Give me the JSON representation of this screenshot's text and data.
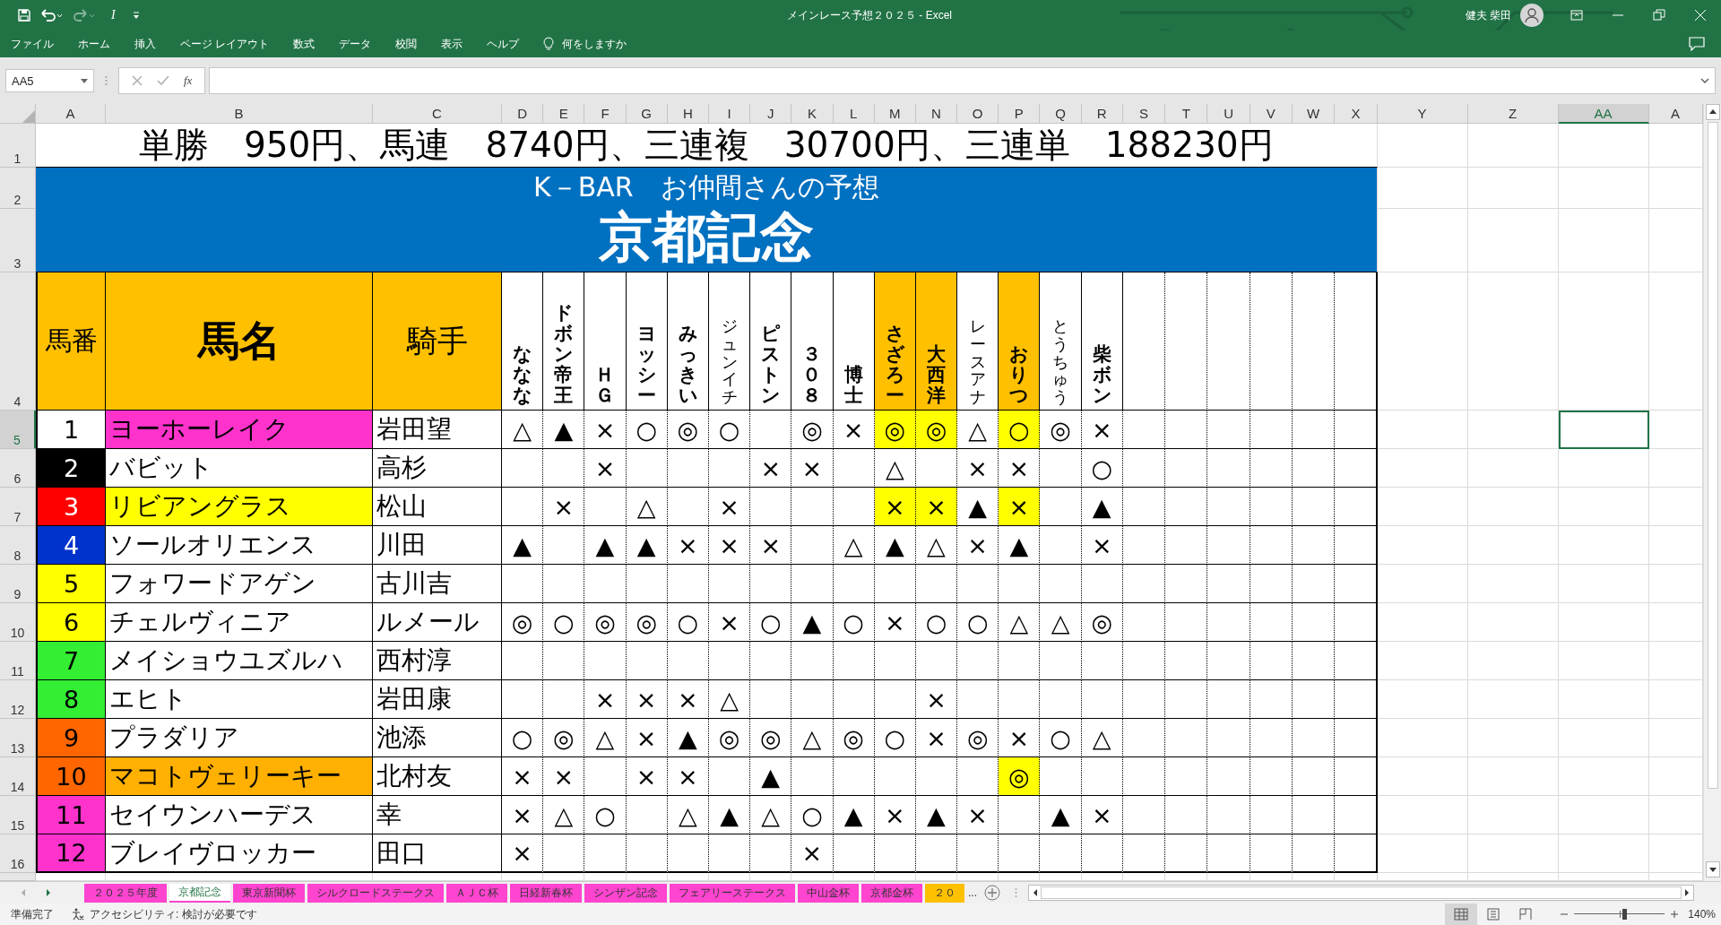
{
  "window": {
    "title": "メインレース予想２０２５  -  Excel",
    "user": "健夫 柴田"
  },
  "quick_access": [
    {
      "kind": "save",
      "disabled": false
    },
    {
      "kind": "undo",
      "disabled": false
    },
    {
      "kind": "redo",
      "disabled": true
    },
    {
      "kind": "text",
      "label": "I",
      "disabled": false
    },
    {
      "kind": "customize",
      "disabled": false
    }
  ],
  "menu": [
    "ファイル",
    "ホーム",
    "挿入",
    "ページ レイアウト",
    "数式",
    "データ",
    "校閲",
    "表示",
    "ヘルプ"
  ],
  "tell_me": "何をしますか",
  "formula_bar": {
    "name_box": "AA5",
    "function_label": "fx"
  },
  "sheet": {
    "columns": [
      {
        "label": "A",
        "selected": false
      },
      {
        "label": "B",
        "selected": false
      },
      {
        "label": "C",
        "selected": false
      },
      {
        "label": "D",
        "selected": false
      },
      {
        "label": "E",
        "selected": false
      },
      {
        "label": "F",
        "selected": false
      },
      {
        "label": "G",
        "selected": false
      },
      {
        "label": "H",
        "selected": false
      },
      {
        "label": "I",
        "selected": false
      },
      {
        "label": "J",
        "selected": false
      },
      {
        "label": "K",
        "selected": false
      },
      {
        "label": "L",
        "selected": false
      },
      {
        "label": "M",
        "selected": false
      },
      {
        "label": "N",
        "selected": false
      },
      {
        "label": "O",
        "selected": false
      },
      {
        "label": "P",
        "selected": false
      },
      {
        "label": "Q",
        "selected": false
      },
      {
        "label": "R",
        "selected": false
      },
      {
        "label": "S",
        "selected": false
      },
      {
        "label": "T",
        "selected": false
      },
      {
        "label": "U",
        "selected": false
      },
      {
        "label": "V",
        "selected": false
      },
      {
        "label": "W",
        "selected": false
      },
      {
        "label": "X",
        "selected": false
      },
      {
        "label": "Y",
        "selected": false
      },
      {
        "label": "Z",
        "selected": false
      },
      {
        "label": "AA",
        "selected": true
      },
      {
        "label": "A",
        "selected": false
      }
    ],
    "rows": [
      {
        "label": "1",
        "selected": false
      },
      {
        "label": "2",
        "selected": false
      },
      {
        "label": "3",
        "selected": false
      },
      {
        "label": "4",
        "selected": false
      },
      {
        "label": "5",
        "selected": true
      },
      {
        "label": "6",
        "selected": false
      },
      {
        "label": "7",
        "selected": false
      },
      {
        "label": "8",
        "selected": false
      },
      {
        "label": "9",
        "selected": false
      },
      {
        "label": "10",
        "selected": false
      },
      {
        "label": "11",
        "selected": false
      },
      {
        "label": "12",
        "selected": false
      },
      {
        "label": "13",
        "selected": false
      },
      {
        "label": "14",
        "selected": false
      },
      {
        "label": "15",
        "selected": false
      },
      {
        "label": "16",
        "selected": false
      }
    ],
    "results": "単勝　950円、馬連　8740円、三連複　30700円、三連単　188230円",
    "banner": {
      "subtitle": "K－BAR　お仲間さんの予想",
      "title": "京都記念"
    },
    "headers": {
      "number": "馬番",
      "name": "馬名",
      "jockey": "騎手"
    },
    "predictors": [
      {
        "name": "ななな",
        "highlighted": false,
        "bold": true
      },
      {
        "name": "ドボン帝王",
        "highlighted": false,
        "bold": true
      },
      {
        "name": "ＨＧ",
        "highlighted": false,
        "bold": true
      },
      {
        "name": "ヨッシー",
        "highlighted": false,
        "bold": true
      },
      {
        "name": "みっきい",
        "highlighted": false,
        "bold": true
      },
      {
        "name": "ジュンイチ",
        "highlighted": false,
        "bold": false
      },
      {
        "name": "ピストン",
        "highlighted": false,
        "bold": true
      },
      {
        "name": "３０８",
        "highlighted": false,
        "bold": true
      },
      {
        "name": "博士",
        "highlighted": false,
        "bold": true
      },
      {
        "name": "さざろー",
        "highlighted": true,
        "bold": true
      },
      {
        "name": "大西洋",
        "highlighted": true,
        "bold": true
      },
      {
        "name": "レースアナ",
        "highlighted": false,
        "bold": false
      },
      {
        "name": "おりつ",
        "highlighted": true,
        "bold": true
      },
      {
        "name": "とうちゅう",
        "highlighted": false,
        "bold": false
      },
      {
        "name": "柴ボン",
        "highlighted": false,
        "bold": true
      }
    ],
    "horses": [
      {
        "number": "1",
        "color": "#ffffff",
        "name": "ヨーホーレイク",
        "name_style": {
          "color": "#ff33cc"
        },
        "jockey": "岩田望",
        "marks": [
          {
            "mark": "△",
            "highlighted": false
          },
          {
            "mark": "▲",
            "highlighted": false
          },
          {
            "mark": "×",
            "highlighted": false
          },
          {
            "mark": "○",
            "highlighted": false
          },
          {
            "mark": "◎",
            "highlighted": false
          },
          {
            "mark": "○",
            "highlighted": false
          },
          {
            "highlighted": false
          },
          {
            "mark": "◎",
            "highlighted": false
          },
          {
            "mark": "×",
            "highlighted": false
          },
          {
            "mark": "◎",
            "highlighted": true
          },
          {
            "mark": "◎",
            "highlighted": true
          },
          {
            "mark": "△",
            "highlighted": false
          },
          {
            "mark": "○",
            "highlighted": true
          },
          {
            "mark": "◎",
            "highlighted": false
          },
          {
            "mark": "×",
            "highlighted": false
          }
        ]
      },
      {
        "number": "2",
        "color": "#000000",
        "name": "バビット",
        "name_style": {
          "color": "#ffffff"
        },
        "jockey": "高杉",
        "marks": [
          {
            "highlighted": false
          },
          {
            "highlighted": false
          },
          {
            "mark": "×",
            "highlighted": false
          },
          {
            "highlighted": false
          },
          {
            "highlighted": false
          },
          {
            "highlighted": false
          },
          {
            "mark": "×",
            "highlighted": false
          },
          {
            "mark": "×",
            "highlighted": false
          },
          {
            "highlighted": false
          },
          {
            "mark": "△",
            "highlighted": false
          },
          {
            "highlighted": false
          },
          {
            "mark": "×",
            "highlighted": false
          },
          {
            "mark": "×",
            "highlighted": false
          },
          {
            "highlighted": false
          },
          {
            "mark": "○",
            "highlighted": false
          }
        ]
      },
      {
        "number": "3",
        "color": "#ff0000",
        "name": "リビアングラス",
        "name_style": {
          "color": "#ffff00"
        },
        "jockey": "松山",
        "marks": [
          {
            "highlighted": false
          },
          {
            "mark": "×",
            "highlighted": false
          },
          {
            "highlighted": false
          },
          {
            "mark": "△",
            "highlighted": false
          },
          {
            "highlighted": false
          },
          {
            "mark": "×",
            "highlighted": false
          },
          {
            "highlighted": false
          },
          {
            "highlighted": false
          },
          {
            "highlighted": false
          },
          {
            "mark": "×",
            "highlighted": true
          },
          {
            "mark": "×",
            "highlighted": true
          },
          {
            "mark": "▲",
            "highlighted": false
          },
          {
            "mark": "×",
            "highlighted": true
          },
          {
            "highlighted": false
          },
          {
            "mark": "▲",
            "highlighted": false
          }
        ]
      },
      {
        "number": "4",
        "color": "#0033cc",
        "name": "ソールオリエンス",
        "name_style": {
          "color": "#ffffff"
        },
        "jockey": "川田",
        "marks": [
          {
            "mark": "▲",
            "highlighted": false
          },
          {
            "highlighted": false
          },
          {
            "mark": "▲",
            "highlighted": false
          },
          {
            "mark": "▲",
            "highlighted": false
          },
          {
            "mark": "×",
            "highlighted": false
          },
          {
            "mark": "×",
            "highlighted": false
          },
          {
            "mark": "×",
            "highlighted": false
          },
          {
            "highlighted": false
          },
          {
            "mark": "△",
            "highlighted": false
          },
          {
            "mark": "▲",
            "highlighted": false
          },
          {
            "mark": "△",
            "highlighted": false
          },
          {
            "mark": "×",
            "highlighted": false
          },
          {
            "mark": "▲",
            "highlighted": false
          },
          {
            "highlighted": false
          },
          {
            "mark": "×",
            "highlighted": false
          }
        ]
      },
      {
        "number": "5",
        "color": "#ffff00",
        "name": "フォワードアゲン",
        "name_style": {
          "color": "#ffffff"
        },
        "jockey": "古川吉",
        "marks": [
          {
            "highlighted": false
          },
          {
            "highlighted": false
          },
          {
            "highlighted": false
          },
          {
            "highlighted": false
          },
          {
            "highlighted": false
          },
          {
            "highlighted": false
          },
          {
            "highlighted": false
          },
          {
            "highlighted": false
          },
          {
            "highlighted": false
          },
          {
            "highlighted": false
          },
          {
            "highlighted": false
          },
          {
            "highlighted": false
          },
          {
            "highlighted": false
          },
          {
            "highlighted": false
          },
          {
            "highlighted": false
          }
        ]
      },
      {
        "number": "6",
        "color": "#ffff00",
        "name": "チェルヴィニア",
        "name_style": {
          "color": "#ffffff"
        },
        "jockey": "ルメール",
        "marks": [
          {
            "mark": "◎",
            "highlighted": false
          },
          {
            "mark": "○",
            "highlighted": false
          },
          {
            "mark": "◎",
            "highlighted": false
          },
          {
            "mark": "◎",
            "highlighted": false
          },
          {
            "mark": "○",
            "highlighted": false
          },
          {
            "mark": "×",
            "highlighted": false
          },
          {
            "mark": "○",
            "highlighted": false
          },
          {
            "mark": "▲",
            "highlighted": false
          },
          {
            "mark": "○",
            "highlighted": false
          },
          {
            "mark": "×",
            "highlighted": false
          },
          {
            "mark": "○",
            "highlighted": false
          },
          {
            "mark": "○",
            "highlighted": false
          },
          {
            "mark": "△",
            "highlighted": false
          },
          {
            "mark": "△",
            "highlighted": false
          },
          {
            "mark": "◎",
            "highlighted": false
          }
        ]
      },
      {
        "number": "7",
        "color": "#33ee33",
        "name": "メイショウユズルハ",
        "name_style": {
          "color": "#ffffff"
        },
        "jockey": "西村淳",
        "marks": [
          {
            "highlighted": false
          },
          {
            "highlighted": false
          },
          {
            "highlighted": false
          },
          {
            "highlighted": false
          },
          {
            "highlighted": false
          },
          {
            "highlighted": false
          },
          {
            "highlighted": false
          },
          {
            "highlighted": false
          },
          {
            "highlighted": false
          },
          {
            "highlighted": false
          },
          {
            "highlighted": false
          },
          {
            "highlighted": false
          },
          {
            "highlighted": false
          },
          {
            "highlighted": false
          },
          {
            "highlighted": false
          }
        ]
      },
      {
        "number": "8",
        "color": "#33ee33",
        "name": "エヒト",
        "name_style": {
          "color": "#ffffff"
        },
        "jockey": "岩田康",
        "marks": [
          {
            "highlighted": false
          },
          {
            "highlighted": false
          },
          {
            "mark": "×",
            "highlighted": false
          },
          {
            "mark": "×",
            "highlighted": false
          },
          {
            "mark": "×",
            "highlighted": false
          },
          {
            "mark": "△",
            "highlighted": false
          },
          {
            "highlighted": false
          },
          {
            "highlighted": false
          },
          {
            "highlighted": false
          },
          {
            "highlighted": false
          },
          {
            "mark": "×",
            "highlighted": false
          },
          {
            "highlighted": false
          },
          {
            "highlighted": false
          },
          {
            "highlighted": false
          },
          {
            "highlighted": false
          }
        ]
      },
      {
        "number": "9",
        "color": "#ff6600",
        "name": "プラダリア",
        "name_style": {
          "color": "#ffffff"
        },
        "jockey": "池添",
        "marks": [
          {
            "mark": "○",
            "highlighted": false
          },
          {
            "mark": "◎",
            "highlighted": false
          },
          {
            "mark": "△",
            "highlighted": false
          },
          {
            "mark": "×",
            "highlighted": false
          },
          {
            "mark": "▲",
            "highlighted": false
          },
          {
            "mark": "◎",
            "highlighted": false
          },
          {
            "mark": "◎",
            "highlighted": false
          },
          {
            "mark": "△",
            "highlighted": false
          },
          {
            "mark": "◎",
            "highlighted": false
          },
          {
            "mark": "○",
            "highlighted": false
          },
          {
            "mark": "×",
            "highlighted": false
          },
          {
            "mark": "◎",
            "highlighted": false
          },
          {
            "mark": "×",
            "highlighted": false
          },
          {
            "mark": "○",
            "highlighted": false
          },
          {
            "mark": "△",
            "highlighted": false
          }
        ]
      },
      {
        "number": "10",
        "color": "#ff6600",
        "name": "マコトヴェリーキー",
        "name_style": {
          "color": "#ffb000"
        },
        "jockey": "北村友",
        "marks": [
          {
            "mark": "×",
            "highlighted": false
          },
          {
            "mark": "×",
            "highlighted": false
          },
          {
            "highlighted": false
          },
          {
            "mark": "×",
            "highlighted": false
          },
          {
            "mark": "×",
            "highlighted": false
          },
          {
            "highlighted": false
          },
          {
            "mark": "▲",
            "highlighted": false
          },
          {
            "highlighted": false
          },
          {
            "highlighted": false
          },
          {
            "highlighted": false
          },
          {
            "highlighted": false
          },
          {
            "highlighted": false
          },
          {
            "mark": "◎",
            "highlighted": true
          },
          {
            "highlighted": false
          },
          {
            "highlighted": false
          }
        ]
      },
      {
        "number": "11",
        "color": "#ff33cc",
        "name": "セイウンハーデス",
        "name_style": {
          "color": "#ffffff"
        },
        "jockey": "幸",
        "marks": [
          {
            "mark": "×",
            "highlighted": false
          },
          {
            "mark": "△",
            "highlighted": false
          },
          {
            "mark": "○",
            "highlighted": false
          },
          {
            "highlighted": false
          },
          {
            "mark": "△",
            "highlighted": false
          },
          {
            "mark": "▲",
            "highlighted": false
          },
          {
            "mark": "△",
            "highlighted": false
          },
          {
            "mark": "○",
            "highlighted": false
          },
          {
            "mark": "▲",
            "highlighted": false
          },
          {
            "mark": "×",
            "highlighted": false
          },
          {
            "mark": "▲",
            "highlighted": false
          },
          {
            "mark": "×",
            "highlighted": false
          },
          {
            "highlighted": false
          },
          {
            "mark": "▲",
            "highlighted": false
          },
          {
            "mark": "×",
            "highlighted": false
          }
        ]
      },
      {
        "number": "12",
        "color": "#ff33cc",
        "name": "ブレイヴロッカー",
        "name_style": {
          "color": "#ffffff"
        },
        "jockey": "田口",
        "marks": [
          {
            "mark": "×",
            "highlighted": false
          },
          {
            "highlighted": false
          },
          {
            "highlighted": false
          },
          {
            "highlighted": false
          },
          {
            "highlighted": false
          },
          {
            "highlighted": false
          },
          {
            "highlighted": false
          },
          {
            "mark": "×",
            "highlighted": false
          },
          {
            "highlighted": false
          },
          {
            "highlighted": false
          },
          {
            "highlighted": false
          },
          {
            "highlighted": false
          },
          {
            "highlighted": false
          },
          {
            "highlighted": false
          },
          {
            "highlighted": false
          }
        ]
      }
    ]
  },
  "sheet_tabs": [
    {
      "label": "２０２５年度",
      "color": "#ff44d0",
      "selected": false
    },
    {
      "label": "京都記念",
      "color": "#ff44d0",
      "selected": true
    },
    {
      "label": "東京新聞杯",
      "color": "#ff44d0",
      "selected": false
    },
    {
      "label": "シルクロードステークス",
      "color": "#ff44d0",
      "selected": false
    },
    {
      "label": "ＡＪＣ杯",
      "color": "#ff44d0",
      "selected": false
    },
    {
      "label": "日経新春杯",
      "color": "#ff44d0",
      "selected": false
    },
    {
      "label": "シンザン記念",
      "color": "#ff44d0",
      "selected": false
    },
    {
      "label": "フェアリーステークス",
      "color": "#ff44d0",
      "selected": false
    },
    {
      "label": "中山金杯",
      "color": "#ff44d0",
      "selected": false
    },
    {
      "label": "京都金杯",
      "color": "#ff44d0",
      "selected": false
    },
    {
      "label": "２０",
      "color": "#ffc000",
      "selected": false
    }
  ],
  "tabs_overflow": "...",
  "status_bar": {
    "ready": "準備完了",
    "accessibility": "アクセシビリティ: 検討が必要です",
    "views": [
      {
        "kind": "normal",
        "selected": true
      },
      {
        "kind": "page_layout",
        "selected": false
      },
      {
        "kind": "page_break",
        "selected": false
      }
    ],
    "zoom": {
      "level": 0.55,
      "label": "140%"
    }
  }
}
